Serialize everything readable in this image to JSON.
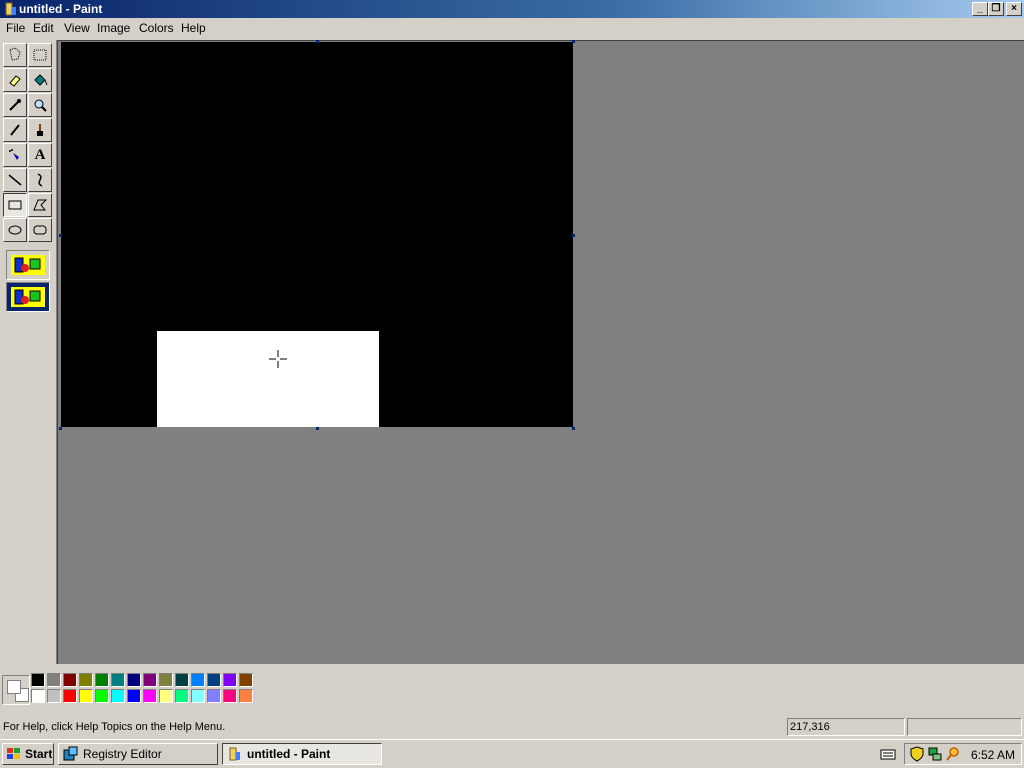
{
  "window": {
    "title": "untitled - Paint"
  },
  "menu": [
    "File",
    "Edit",
    "View",
    "Image",
    "Colors",
    "Help"
  ],
  "tools": [
    {
      "name": "free-form-select-icon"
    },
    {
      "name": "select-icon"
    },
    {
      "name": "eraser-icon"
    },
    {
      "name": "fill-with-color-icon"
    },
    {
      "name": "pick-color-icon"
    },
    {
      "name": "magnifier-icon"
    },
    {
      "name": "pencil-icon"
    },
    {
      "name": "brush-icon"
    },
    {
      "name": "airbrush-icon"
    },
    {
      "name": "text-icon",
      "glyph": "A"
    },
    {
      "name": "line-icon"
    },
    {
      "name": "curve-icon"
    },
    {
      "name": "rectangle-icon"
    },
    {
      "name": "polygon-icon"
    },
    {
      "name": "ellipse-icon"
    },
    {
      "name": "rounded-rectangle-icon"
    }
  ],
  "selected_tool": "rectangle-icon",
  "canvas": {
    "background": "#000000",
    "shape_color": "#ffffff"
  },
  "palette": {
    "foreground": "#ffffff",
    "background": "#ffffff",
    "row1": [
      "#000000",
      "#808080",
      "#800000",
      "#808000",
      "#008000",
      "#008080",
      "#000080",
      "#800080",
      "#808040",
      "#004040",
      "#0080ff",
      "#004080",
      "#8000ff",
      "#804000"
    ],
    "row2": [
      "#ffffff",
      "#c0c0c0",
      "#ff0000",
      "#ffff00",
      "#00ff00",
      "#00ffff",
      "#0000ff",
      "#ff00ff",
      "#ffff80",
      "#00ff80",
      "#80ffff",
      "#8080ff",
      "#ff0080",
      "#ff8040"
    ]
  },
  "status": {
    "help": "For Help, click Help Topics on the Help Menu.",
    "coords": "217,316",
    "size": ""
  },
  "taskbar": {
    "start": "Start",
    "tasks": [
      {
        "label": "Registry Editor",
        "active": false
      },
      {
        "label": "untitled - Paint",
        "active": true
      }
    ],
    "clock": "6:52 AM"
  }
}
